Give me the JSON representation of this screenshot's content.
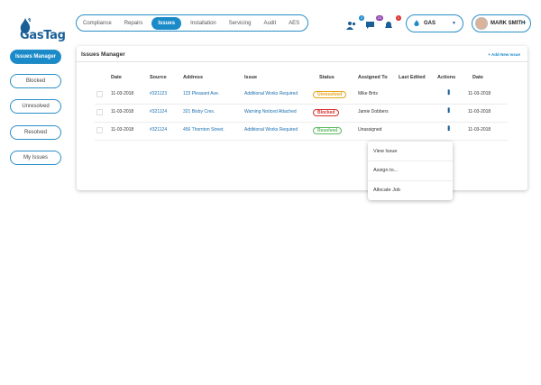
{
  "brand": {
    "name": "GasTag"
  },
  "nav": [
    "Compliance",
    "Repairs",
    "Issues",
    "Installation",
    "Servicing",
    "Audit",
    "AES"
  ],
  "header_badges": {
    "a": "3",
    "b": "23",
    "c": "1"
  },
  "gas_select": "GAS",
  "user": "MARK SMITH",
  "sidebar": [
    "Issues Manager",
    "Blocked",
    "Unresolved",
    "Resolved",
    "My Issues"
  ],
  "card": {
    "title": "Issues Manager",
    "add_label": "Add New Issue"
  },
  "columns": [
    "Date",
    "Source",
    "Address",
    "Issue",
    "Status",
    "Assigned To",
    "Last Edited",
    "Actions",
    "Date"
  ],
  "rows": [
    {
      "date": "11-03-2018",
      "source": "#321123",
      "address": "123 Pleasant Ave.",
      "issue": "Additional Works Required",
      "status": "Unresolved",
      "assigned": "Mike Brits",
      "last_edited": "",
      "date2": "11-03-2018"
    },
    {
      "date": "11-03-2018",
      "source": "#321124",
      "address": "321 Bixby Cres.",
      "issue": "Warning Noticed Attached",
      "status": "Blocked",
      "assigned": "Jamie Dobbers",
      "last_edited": "",
      "date2": "11-03-2018"
    },
    {
      "date": "11-03-2018",
      "source": "#321124",
      "address": "456 Thornton Street.",
      "issue": "Additional Works Required",
      "status": "Resolved",
      "assigned": "Unassigned",
      "last_edited": "",
      "date2": "11-03-2018"
    }
  ],
  "status_colors": {
    "Unresolved": "#e8a317",
    "Blocked": "#d9302c",
    "Resolved": "#5cb85c"
  },
  "context_menu": [
    "View Issue",
    "Assign to...",
    "Allocate Job"
  ],
  "colors": {
    "accent": "#1a8ac9",
    "brand": "#1a5f97"
  }
}
